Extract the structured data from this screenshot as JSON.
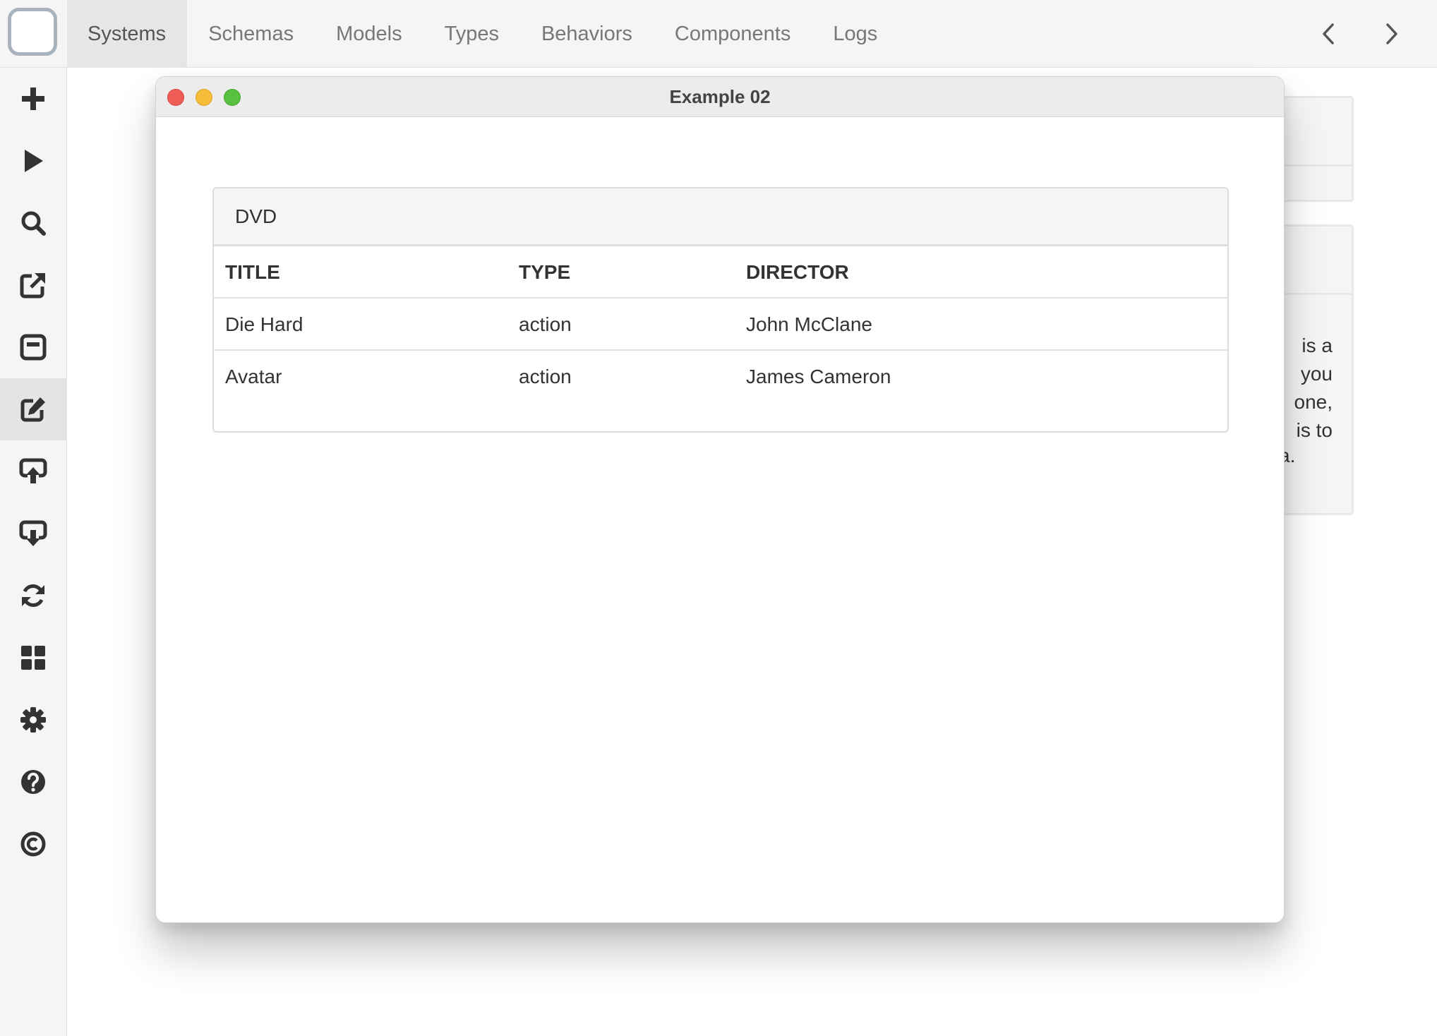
{
  "topbar": {
    "tabs": [
      {
        "label": "Systems",
        "active": true
      },
      {
        "label": "Schemas"
      },
      {
        "label": "Models"
      },
      {
        "label": "Types"
      },
      {
        "label": "Behaviors"
      },
      {
        "label": "Components"
      },
      {
        "label": "Logs"
      }
    ],
    "back_icon": "chevron-left-icon",
    "forward_icon": "chevron-right-icon"
  },
  "sidebar": {
    "items": [
      {
        "icon": "plus-icon"
      },
      {
        "icon": "play-icon"
      },
      {
        "icon": "search-icon"
      },
      {
        "icon": "external-link-icon"
      },
      {
        "icon": "window-icon"
      },
      {
        "icon": "edit-icon",
        "active": true
      },
      {
        "icon": "upload-icon"
      },
      {
        "icon": "download-icon"
      },
      {
        "icon": "refresh-icon"
      },
      {
        "icon": "grid-icon"
      },
      {
        "icon": "gear-icon"
      },
      {
        "icon": "help-icon"
      },
      {
        "icon": "copyright-icon"
      }
    ]
  },
  "background": {
    "text_lines": [
      "is  a",
      "you",
      "one,",
      "is  to"
    ],
    "text_last": "a."
  },
  "window": {
    "title": "Example 02",
    "card": {
      "header": "DVD",
      "columns": [
        "TITLE",
        "TYPE",
        "DIRECTOR"
      ],
      "rows": [
        [
          "Die Hard",
          "action",
          "John McClane"
        ],
        [
          "Avatar",
          "action",
          "James Cameron"
        ]
      ]
    }
  },
  "colors": {
    "close": "#ee5d55",
    "minimize": "#f6bd3b",
    "maximize": "#5ac140",
    "icon": "#333333"
  }
}
